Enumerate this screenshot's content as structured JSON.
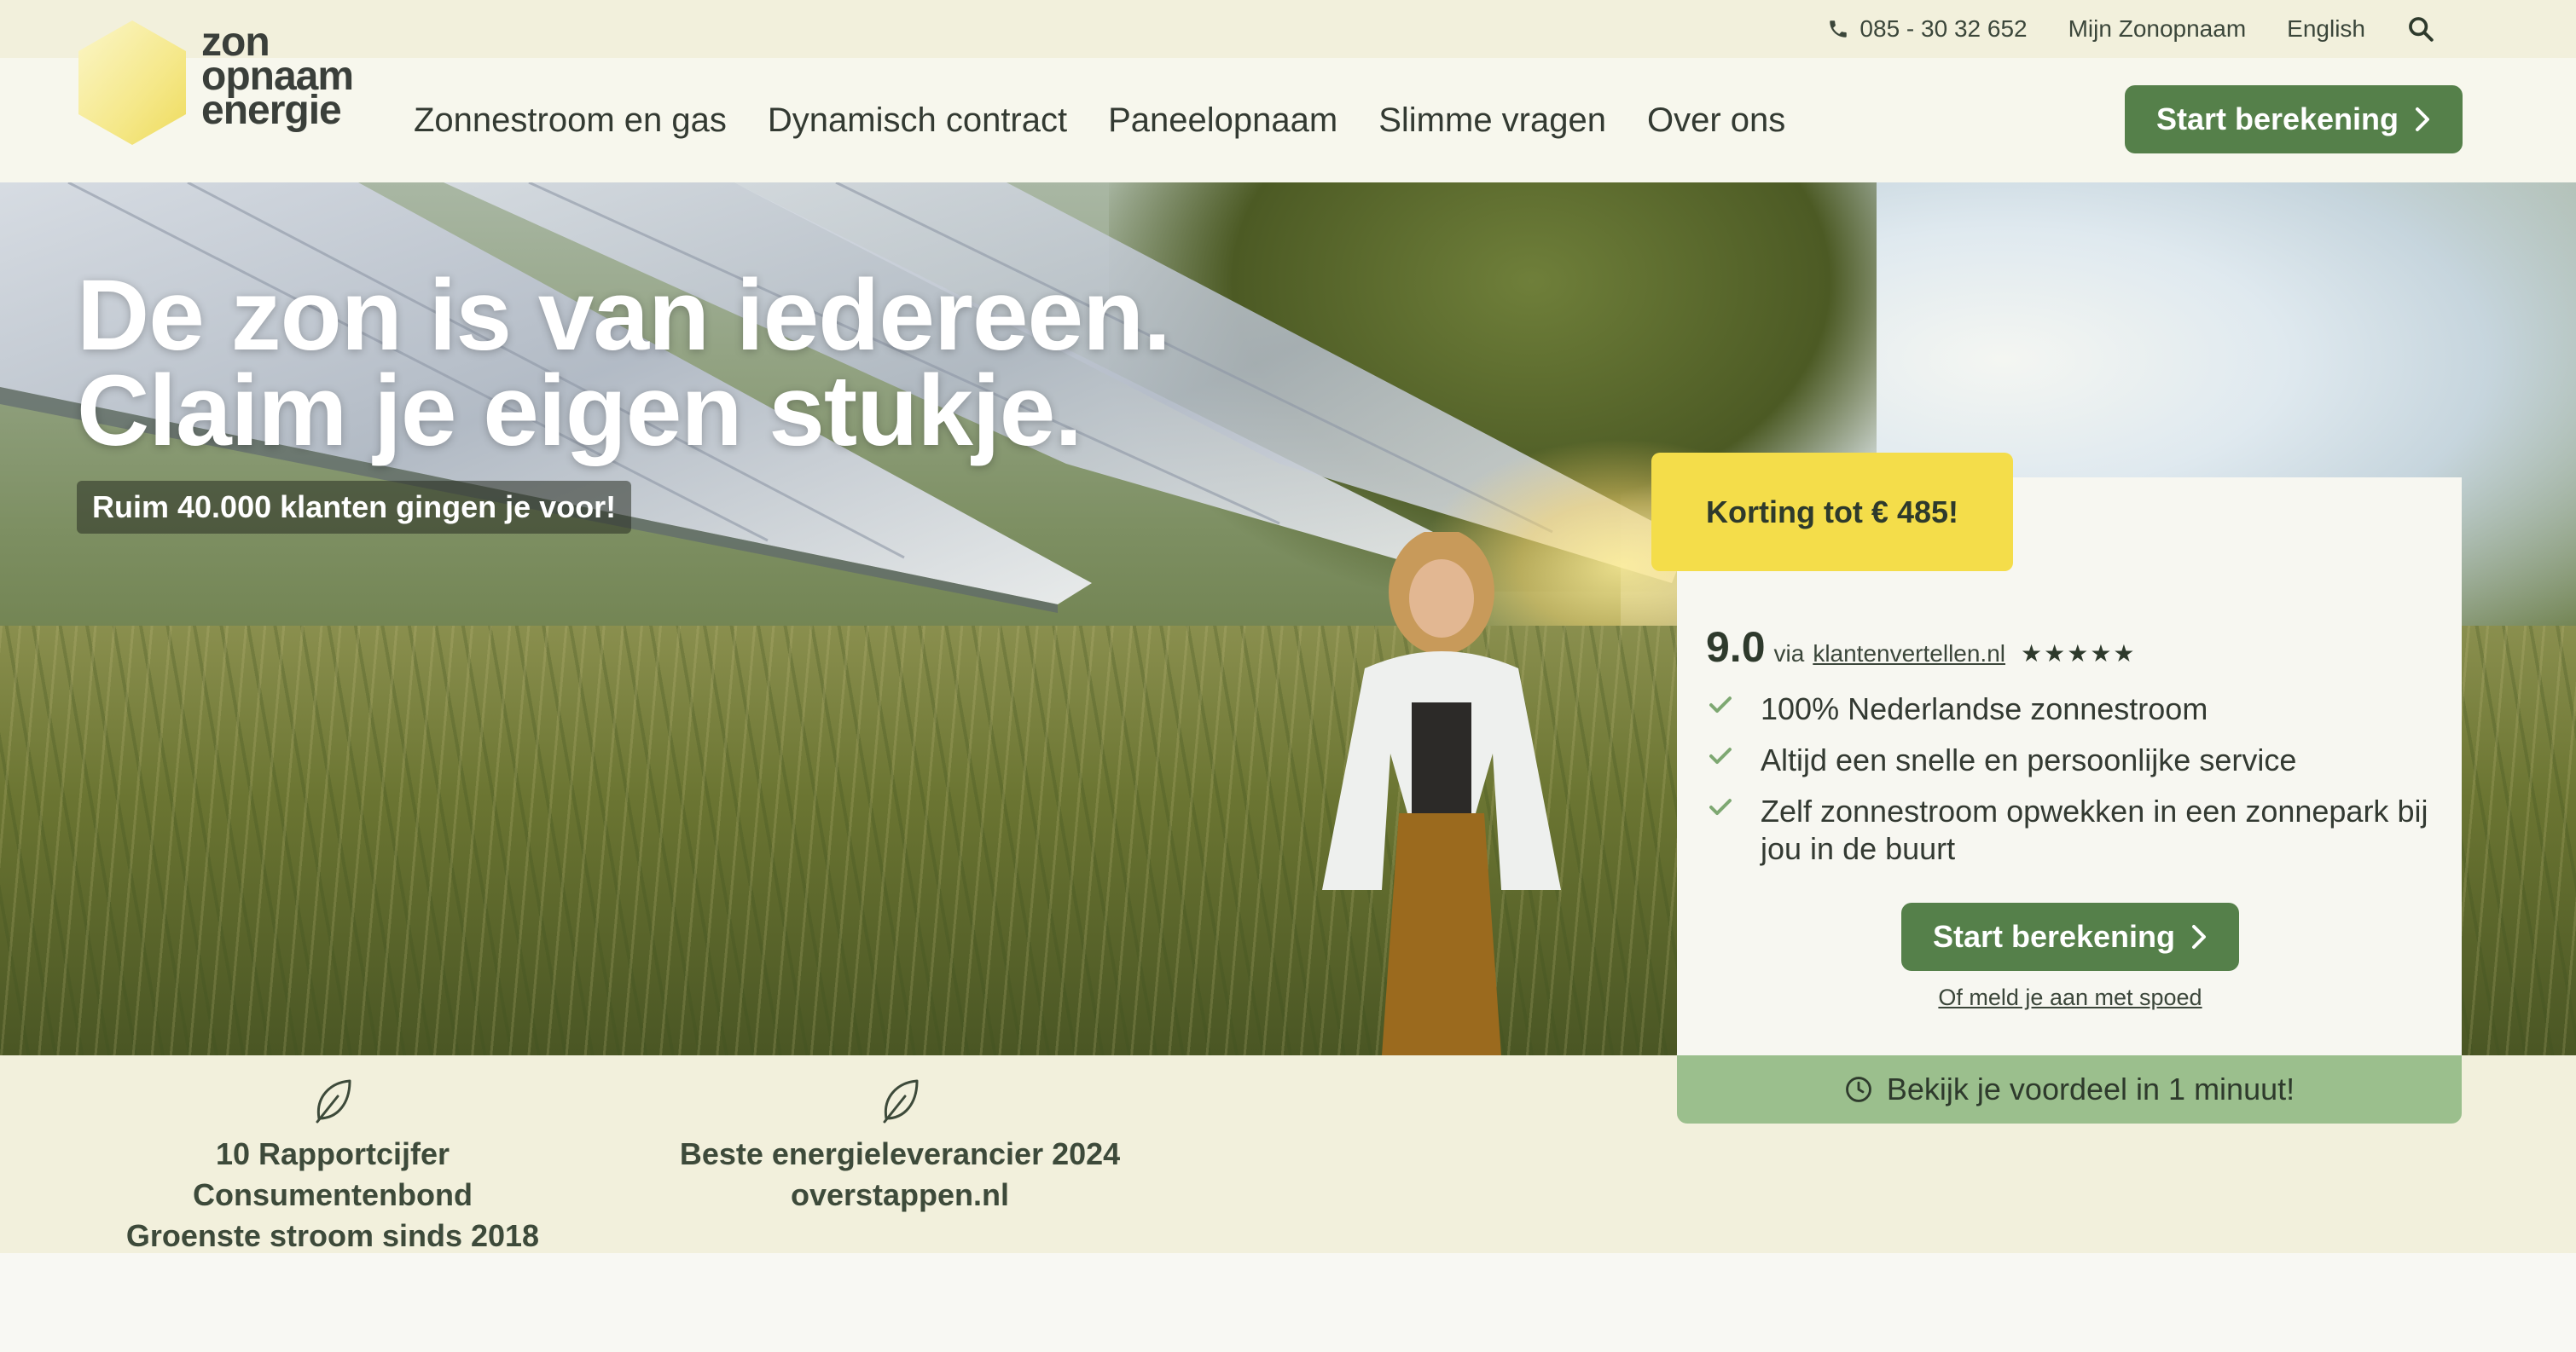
{
  "utility": {
    "phone": "085 - 30 32 652",
    "account_link": "Mijn Zonopnaam",
    "language_link": "English"
  },
  "logo": {
    "line1": "zon",
    "line2": "opnaam",
    "line3": "energie"
  },
  "nav": {
    "items": [
      {
        "label": "Zonnestroom en gas"
      },
      {
        "label": "Dynamisch contract"
      },
      {
        "label": "Paneelopnaam"
      },
      {
        "label": "Slimme vragen"
      },
      {
        "label": "Over ons"
      }
    ],
    "cta_label": "Start berekening"
  },
  "hero": {
    "title_line1": "De zon is van iedereen.",
    "title_line2": "Claim je eigen stukje.",
    "badge": "Ruim 40.000 klanten gingen je voor!"
  },
  "offer": {
    "discount": "Korting tot € 485!",
    "rating_score": "9.0",
    "rating_via": "via",
    "rating_source": "klantenvertellen.nl",
    "rating_stars": "★★★★★",
    "rating_value": 4.5,
    "usps": [
      "100% Nederlandse zonnestroom",
      "Altijd een snelle en persoonlijke service",
      "Zelf zonnestroom opwekken in een zonnepark bij jou in de buurt"
    ],
    "cta_label": "Start berekening",
    "sub_link": "Of meld je aan met spoed",
    "info_strip": "Bekijk je voordeel in 1 minuut!"
  },
  "awards": [
    {
      "line1": "10 Rapportcijfer Consumentenbond",
      "line2": "Groenste stroom sinds 2018"
    },
    {
      "line1": "Beste energieleverancier 2024",
      "line2": "overstappen.nl"
    }
  ],
  "colors": {
    "brand_green": "#55804a",
    "accent_yellow": "#f4dd4a",
    "strip_green": "#9bbf8d",
    "cream": "#f2f0dc"
  }
}
